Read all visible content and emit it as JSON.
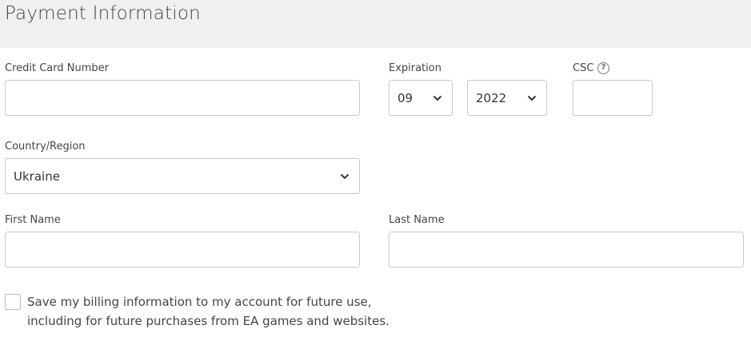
{
  "header": {
    "title": "Payment Information"
  },
  "card": {
    "number_label": "Credit Card Number",
    "number_value": ""
  },
  "expiration": {
    "label": "Expiration",
    "month": "09",
    "year": "2022"
  },
  "csc": {
    "label": "CSC",
    "help_icon": "?",
    "value": ""
  },
  "country": {
    "label": "Country/Region",
    "selected": "Ukraine"
  },
  "first_name": {
    "label": "First Name",
    "value": ""
  },
  "last_name": {
    "label": "Last Name",
    "value": ""
  },
  "save_billing": {
    "checked": false,
    "line1": "Save my billing information to my account for future use,",
    "line2": "including for future purchases from EA games and websites."
  },
  "icons": {
    "dropdown": "chevron-down-icon",
    "help": "help-circle-icon"
  },
  "colors": {
    "header_bg": "#eef0f1",
    "border": "#c9c9c9"
  }
}
